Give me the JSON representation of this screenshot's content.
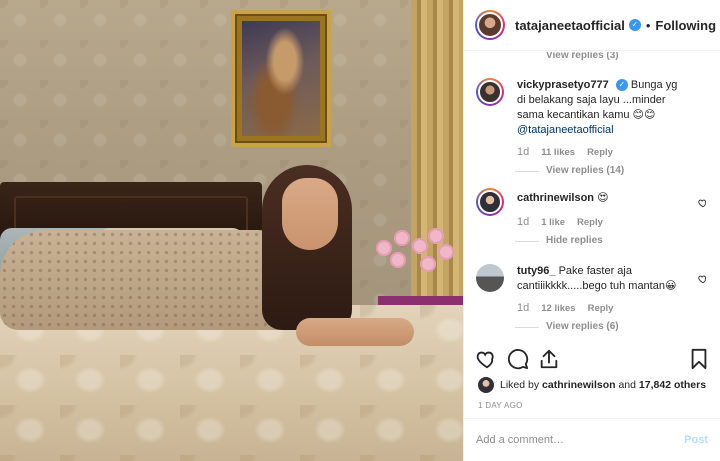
{
  "post": {
    "author": "tatajaneetaofficial",
    "follow_status": "Following",
    "separator": "•"
  },
  "comments": {
    "top_view_replies": "View replies (3)",
    "items": [
      {
        "username": "vickyprasetyo777",
        "verified": true,
        "text": "Bunga yg di belakang saja layu ...minder sama kecantikan kamu 😊😊",
        "mention": "@tatajaneetaofficial",
        "time": "1d",
        "likes": "11 likes",
        "reply": "Reply",
        "replies": "View replies (14)"
      },
      {
        "username": "cathrinewilson",
        "verified": false,
        "text": "😍",
        "mention": "",
        "time": "1d",
        "likes": "1 like",
        "reply": "Reply",
        "replies": "Hide replies"
      },
      {
        "username": "tuty96_",
        "verified": false,
        "text": "Pake faster aja cantiiikkkk.....bego tuh mantan😀",
        "mention": "",
        "time": "1d",
        "likes": "12 likes",
        "reply": "Reply",
        "replies": "View replies (6)"
      }
    ]
  },
  "likes": {
    "prefix": "Liked by",
    "user": "cathrinewilson",
    "conj": "and",
    "others": "17,842 others"
  },
  "date": "1 DAY AGO",
  "add_comment": {
    "placeholder": "Add a comment…",
    "post_label": "Post"
  },
  "colors": {
    "link_blue": "#3897f0",
    "muted": "#8e8e8e",
    "post_disabled": "#b2dffc"
  }
}
